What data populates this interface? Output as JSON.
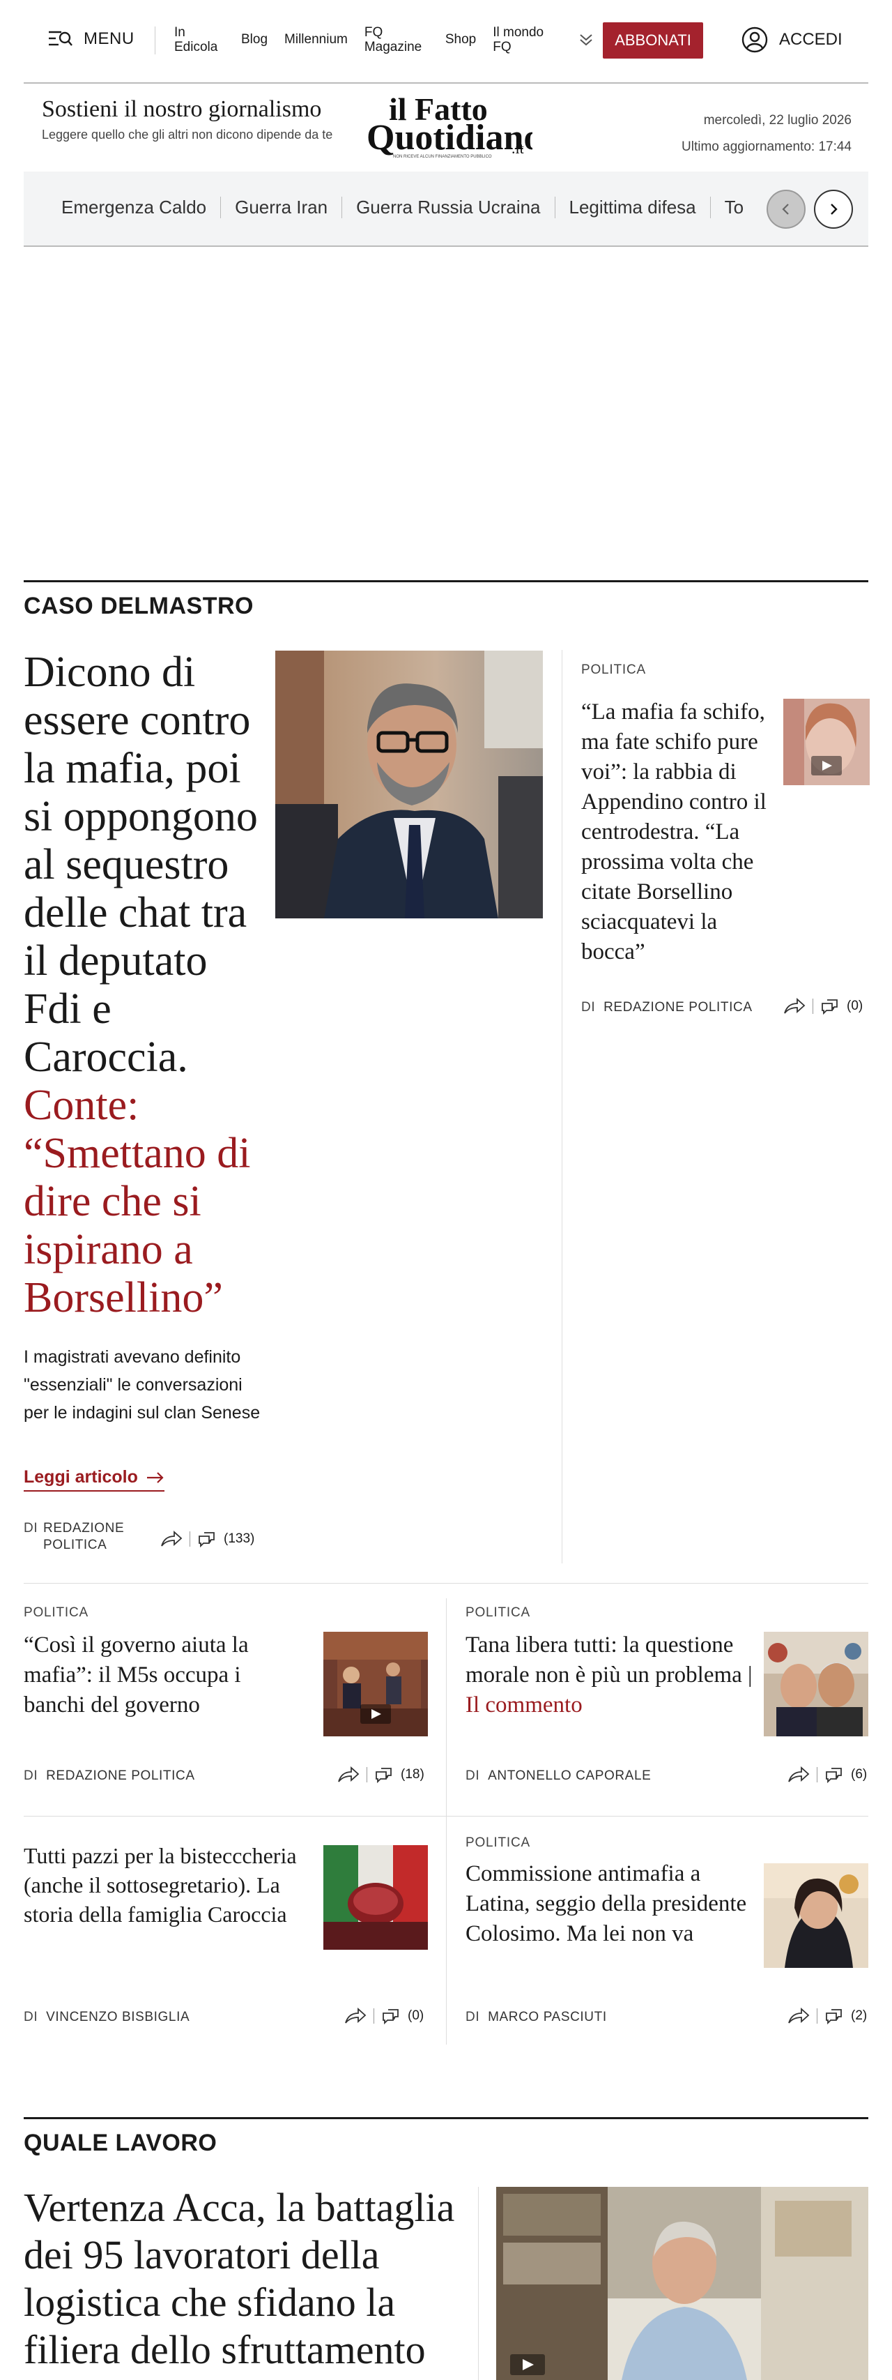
{
  "nav": {
    "menu_label": "MENU",
    "links": [
      "In Edicola",
      "Blog",
      "Millennium",
      "FQ Magazine",
      "Shop",
      "Il mondo FQ"
    ],
    "subscribe_label": "ABBONATI",
    "login_label": "ACCEDI"
  },
  "masthead": {
    "support_title": "Sostieni il nostro giornalismo",
    "support_subtitle": "Leggere quello che gli altri non dicono dipende da te",
    "logo_line1": "il Fatto",
    "logo_line2": "Quotidiano",
    "logo_suffix": ".it",
    "logo_tagline": "NON RICEVE ALCUN FINANZIAMENTO PUBBLICO",
    "date": "mercoledì, 22 luglio 2026",
    "updated": "Ultimo aggiornamento: 17:44"
  },
  "trending": {
    "items": [
      "Emergenza Caldo",
      "Guerra Iran",
      "Guerra Russia Ucraina",
      "Legittima difesa",
      "To"
    ],
    "prev_icon": "chevron-left-icon",
    "next_icon": "chevron-right-icon"
  },
  "section1": {
    "title": "CASO DELMASTRO",
    "main": {
      "title": "Dicono di essere contro la mafia, poi si oppongono al sequestro delle chat tra il deputato Fdi e Caroccia.",
      "title_red": "Conte: “Smettano di dire che si ispirano a Borsellino”",
      "summary": "I magistrati avevano definito \"essenziali\" le conversazioni per le indagini sul clan Senese",
      "read_more": "Leggi articolo",
      "by": "DI",
      "author": "REDAZIONE POLITICA",
      "comments": "(133)"
    },
    "side": {
      "kicker": "POLITICA",
      "title": "“La mafia fa schifo, ma fate schifo pure voi”: la rabbia di Appendino contro il centrodestra. “La prossima volta che citate Borsellino sciacquatevi la bocca”",
      "by": "DI",
      "author": "REDAZIONE POLITICA",
      "comments": "(0)"
    },
    "grid": [
      {
        "kicker": "POLITICA",
        "title": "“Così il governo aiuta la mafia”: il M5s occupa i banchi del governo",
        "title_red": "",
        "by": "DI",
        "author": "REDAZIONE POLITICA",
        "comments": "(18)"
      },
      {
        "kicker": "POLITICA",
        "title": "Tana libera tutti: la questione morale non è più un problema |",
        "title_red": "Il commento",
        "by": "DI",
        "author": "ANTONELLO CAPORALE",
        "comments": "(6)"
      },
      {
        "kicker": "",
        "title": "Tutti pazzi per la bistecccheria (anche il sottosegretario). La storia della famiglia Caroccia",
        "title_red": "",
        "by": "DI",
        "author": "VINCENZO BISBIGLIA",
        "comments": "(0)"
      },
      {
        "kicker": "POLITICA",
        "title": "Commissione antimafia a Latina, seggio della presidente Colosimo. Ma lei non va",
        "title_red": "",
        "by": "DI",
        "author": "MARCO PASCIUTI",
        "comments": "(2)"
      }
    ]
  },
  "section2": {
    "title": "QUALE LAVORO",
    "main_title": "Vertenza Acca, la battaglia dei 95 lavoratori della logistica che sfidano la filiera dello sfruttamento"
  },
  "colors": {
    "accent": "#a4222d",
    "headline_red": "#9a1b1f",
    "trend_bg": "#f3f4f5"
  }
}
